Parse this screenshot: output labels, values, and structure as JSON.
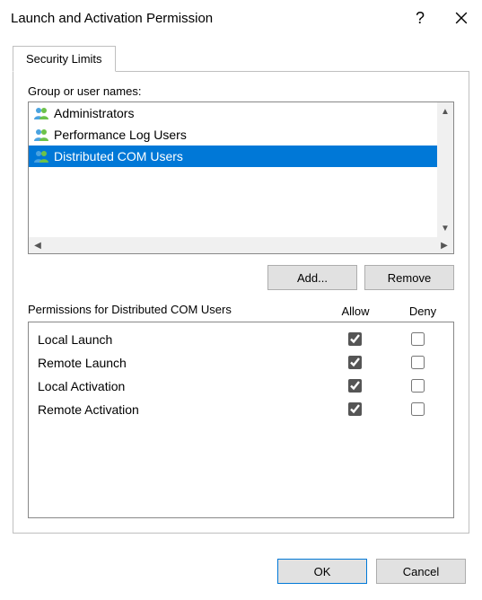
{
  "window": {
    "title": "Launch and Activation Permission"
  },
  "tabs": {
    "security_limits": "Security Limits"
  },
  "group_label_prefix": "Group or user names:",
  "groups": [
    {
      "name": "Administrators",
      "selected": false
    },
    {
      "name": "Performance Log Users",
      "selected": false
    },
    {
      "name": "Distributed COM Users",
      "selected": true
    }
  ],
  "buttons": {
    "add": "Add...",
    "remove": "Remove",
    "ok": "OK",
    "cancel": "Cancel"
  },
  "perm_label": "Permissions for Distributed COM Users",
  "perm_columns": {
    "allow": "Allow",
    "deny": "Deny"
  },
  "permissions": [
    {
      "name": "Local Launch",
      "allow": true,
      "deny": false
    },
    {
      "name": "Remote Launch",
      "allow": true,
      "deny": false
    },
    {
      "name": "Local Activation",
      "allow": true,
      "deny": false
    },
    {
      "name": "Remote Activation",
      "allow": true,
      "deny": false
    }
  ]
}
